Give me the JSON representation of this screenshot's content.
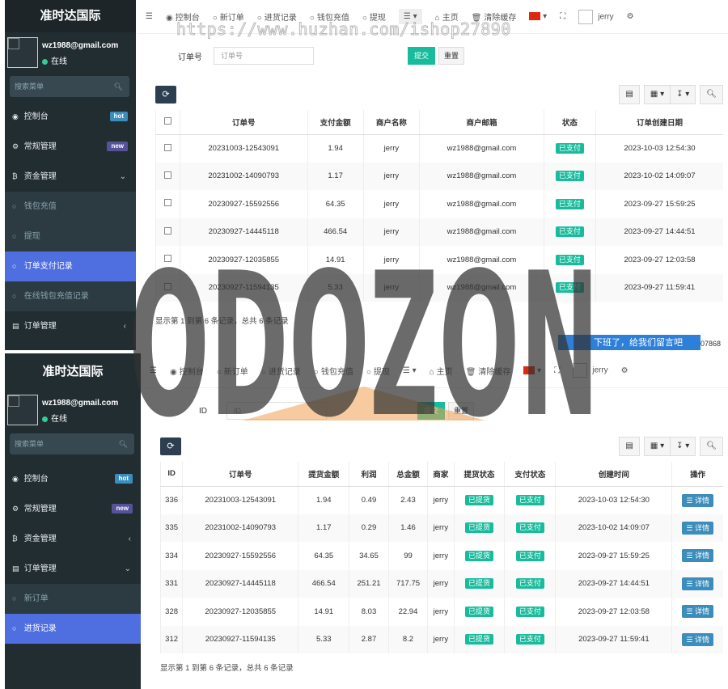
{
  "p1": {
    "brand": "准时达国际",
    "user_email": "wz1988@gmail.com",
    "user_status": "在线",
    "search_placeholder": "搜索菜单",
    "menu": {
      "dashboard": "控制台",
      "dashboard_badge": "hot",
      "general": "常规管理",
      "general_badge": "new",
      "funds": "资金管理",
      "wallet": "钱包充值",
      "withdraw": "提现",
      "order_pay": "订单支付记录",
      "online_wallet": "在线钱包充值记录",
      "order_mgmt": "订单管理"
    },
    "topnav": {
      "dashboard": "控制台",
      "new_order": "新订单",
      "purchase": "进货记录",
      "wallet": "钱包充值",
      "withdraw": "提现",
      "home": "主页",
      "clear_cache": "清除缓存",
      "user": "jerry"
    },
    "filter": {
      "label": "订单号",
      "placeholder": "订单号",
      "submit": "提交",
      "reset": "重置"
    },
    "columns": [
      "订单号",
      "支付金额",
      "商户名称",
      "商户邮箱",
      "状态",
      "订单创建日期"
    ],
    "rows": [
      [
        "20231003-12543091",
        "1.94",
        "jerry",
        "wz1988@gmail.com",
        "已支付",
        "2023-10-03 12:54:30"
      ],
      [
        "20231002-14090793",
        "1.17",
        "jerry",
        "wz1988@gmail.com",
        "已支付",
        "2023-10-02 14:09:07"
      ],
      [
        "20230927-15592556",
        "64.35",
        "jerry",
        "wz1988@gmail.com",
        "已支付",
        "2023-09-27 15:59:25"
      ],
      [
        "20230927-14445118",
        "466.54",
        "jerry",
        "wz1988@gmail.com",
        "已支付",
        "2023-09-27 14:44:51"
      ],
      [
        "20230927-12035855",
        "14.91",
        "jerry",
        "wz1988@gmail.com",
        "已支付",
        "2023-09-27 12:03:58"
      ],
      [
        "20230927-11594135",
        "5.33",
        "jerry",
        "wz1988@gmail.com",
        "已支付",
        "2023-09-27 11:59:41"
      ]
    ],
    "footer": "显示第 1 到第 6 条记录，总共 6 条记录",
    "chat": "下班了，给我们留言吧",
    "chat_num": "07868"
  },
  "p2": {
    "brand": "准时达国际",
    "user_email": "wz1988@gmail.com",
    "user_status": "在线",
    "search_placeholder": "搜索菜单",
    "menu": {
      "dashboard": "控制台",
      "dashboard_badge": "hot",
      "general": "常规管理",
      "general_badge": "new",
      "funds": "资金管理",
      "order_mgmt": "订单管理",
      "new_order": "新订单",
      "purchase": "进货记录"
    },
    "topnav": {
      "dashboard": "控制台",
      "new_order": "新订单",
      "purchase": "进货记录",
      "wallet": "钱包充值",
      "withdraw": "提现",
      "home": "主页",
      "clear_cache": "清除缓存",
      "user": "jerry"
    },
    "filter": {
      "label": "ID",
      "placeholder": "ID",
      "submit": "提交",
      "reset": "重置"
    },
    "columns": [
      "ID",
      "订单号",
      "提货金额",
      "利润",
      "总金额",
      "商家",
      "提货状态",
      "支付状态",
      "创建时间",
      "操作"
    ],
    "rows": [
      [
        "336",
        "20231003-12543091",
        "1.94",
        "0.49",
        "2.43",
        "jerry",
        "已提货",
        "已支付",
        "2023-10-03 12:54:30",
        "详情"
      ],
      [
        "335",
        "20231002-14090793",
        "1.17",
        "0.29",
        "1.46",
        "jerry",
        "已提货",
        "已支付",
        "2023-10-02 14:09:07",
        "详情"
      ],
      [
        "334",
        "20230927-15592556",
        "64.35",
        "34.65",
        "99",
        "jerry",
        "已提货",
        "已支付",
        "2023-09-27 15:59:25",
        "详情"
      ],
      [
        "331",
        "20230927-14445118",
        "466.54",
        "251.21",
        "717.75",
        "jerry",
        "已提货",
        "已支付",
        "2023-09-27 14:44:51",
        "详情"
      ],
      [
        "328",
        "20230927-12035855",
        "14.91",
        "8.03",
        "22.94",
        "jerry",
        "已提货",
        "已支付",
        "2023-09-27 12:03:58",
        "详情"
      ],
      [
        "312",
        "20230927-11594135",
        "5.33",
        "2.87",
        "8.2",
        "jerry",
        "已提货",
        "已支付",
        "2023-09-27 11:59:41",
        "详情"
      ]
    ],
    "footer": "显示第 1 到第 6 条记录，总共 6 条记录"
  },
  "watermark": {
    "url": "https://www.huzhan.com/ishop27890",
    "logo": "ODOZON"
  },
  "colors": {
    "sidebar": "#222d32",
    "active": "#4f6ee0",
    "paid": "#18bc9c",
    "detail": "#3c8dbc"
  }
}
